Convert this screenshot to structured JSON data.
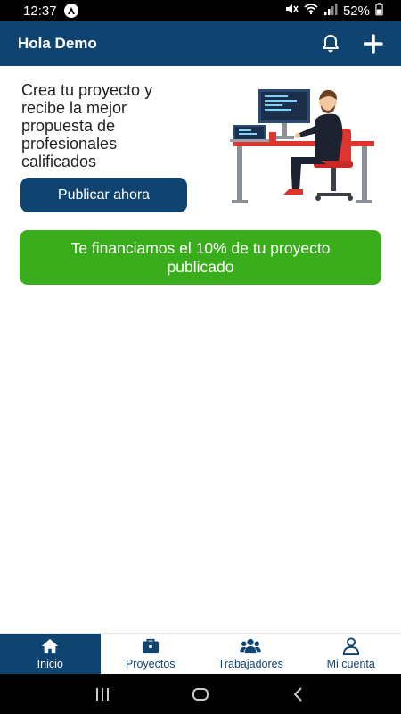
{
  "status_bar": {
    "time": "12:37",
    "battery": "52%",
    "icons": [
      "app-notification-icon",
      "mute-icon",
      "wifi-icon",
      "signal-icon",
      "battery-icon"
    ]
  },
  "app_bar": {
    "title": "Hola Demo",
    "icons": [
      "bell-icon",
      "plus-icon"
    ]
  },
  "hero": {
    "text": "Crea tu proyecto y recibe la mejor propuesta de profesionales calificados",
    "button_label": "Publicar ahora",
    "illustration": "developer-at-desk-illustration"
  },
  "banner": {
    "text": "Te financiamos el 10% de tu proyecto publicado"
  },
  "bottom_nav": {
    "items": [
      {
        "label": "Inicio",
        "icon": "home-icon",
        "active": true
      },
      {
        "label": "Proyectos",
        "icon": "briefcase-icon",
        "active": false
      },
      {
        "label": "Trabajadores",
        "icon": "users-icon",
        "active": false
      },
      {
        "label": "Mi cuenta",
        "icon": "user-icon",
        "active": false
      }
    ]
  },
  "colors": {
    "primary": "#0f4370",
    "accent_green": "#3aad1c",
    "illustration_red": "#e0342e"
  }
}
